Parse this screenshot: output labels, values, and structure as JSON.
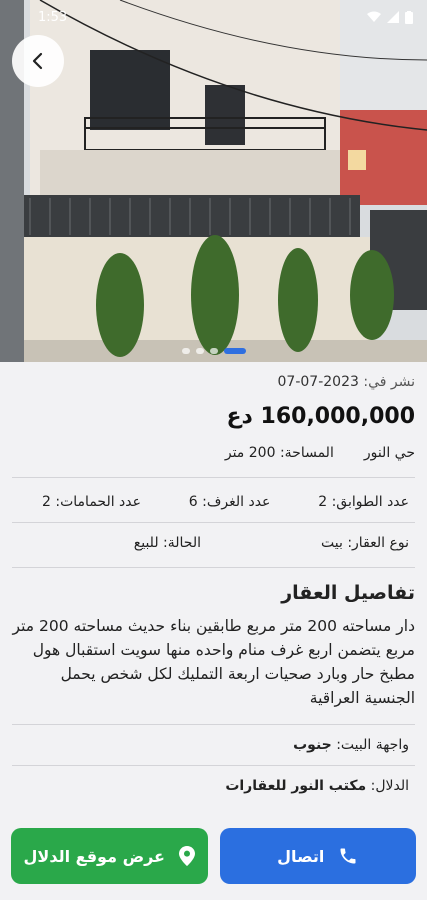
{
  "status_bar": {
    "time": "1:53"
  },
  "listing": {
    "posted_label": "نشر في:",
    "posted_date": "2023-07-07",
    "price": "160,000,000 دع",
    "district": "حي النور",
    "area_label": "المساحة:",
    "area_value": "200 متر",
    "floors_label": "عدد الطوابق:",
    "floors_value": "2",
    "rooms_label": "عدد الغرف:",
    "rooms_value": "6",
    "baths_label": "عدد الحمامات:",
    "baths_value": "2",
    "type_label": "نوع العقار:",
    "type_value": "بيت",
    "status_label": "الحالة:",
    "status_value": "للبيع",
    "details_title": "تفاصيل العقار",
    "description": "دار مساحته 200 متر مربع طابقين بناء حديث مساحته 200 متر مربع يتضمن اربع غرف منام واحده منها سويت استقبال هول مطبخ حار وبارد صحيات اربعة التمليك لكل شخص يحمل الجنسية العراقية",
    "facing_label": "واجهة البيت:",
    "facing_value": "جنوب",
    "broker_label": "الدلال:",
    "broker_value": "مكتب النور للعقارات"
  },
  "actions": {
    "call_label": "اتصال",
    "broker_location_label": "عرض موقع الدلال"
  },
  "colors": {
    "call": "#2b6fe0",
    "location": "#2aa84a",
    "carousel_active": "#2f6fe0"
  }
}
